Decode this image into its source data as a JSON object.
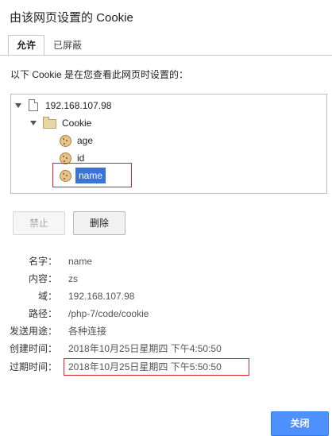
{
  "dialog": {
    "title": "由该网页设置的 Cookie"
  },
  "tabs": [
    {
      "label": "允许",
      "active": true
    },
    {
      "label": "已屏蔽",
      "active": false
    }
  ],
  "description": "以下 Cookie 是在您查看此网页时设置的：",
  "tree": {
    "host": "192.168.107.98",
    "folder": "Cookie",
    "cookies": [
      "age",
      "id",
      "name"
    ],
    "selected": "name"
  },
  "buttons": {
    "block": "禁止",
    "remove": "删除",
    "close": "关闭"
  },
  "details": [
    {
      "label": "名字：",
      "value": "name"
    },
    {
      "label": "内容：",
      "value": "zs"
    },
    {
      "label": "域：",
      "value": "192.168.107.98"
    },
    {
      "label": "路径：",
      "value": "/php-7/code/cookie"
    },
    {
      "label": "发送用途：",
      "value": "各种连接"
    },
    {
      "label": "创建时间：",
      "value": "2018年10月25日星期四 下午4:50:50"
    },
    {
      "label": "过期时间：",
      "value": "2018年10月25日星期四 下午5:50:50"
    }
  ],
  "colors": {
    "accent": "#4d90fe",
    "highlight_box": "#d9252a",
    "selection": "#3875d7"
  }
}
